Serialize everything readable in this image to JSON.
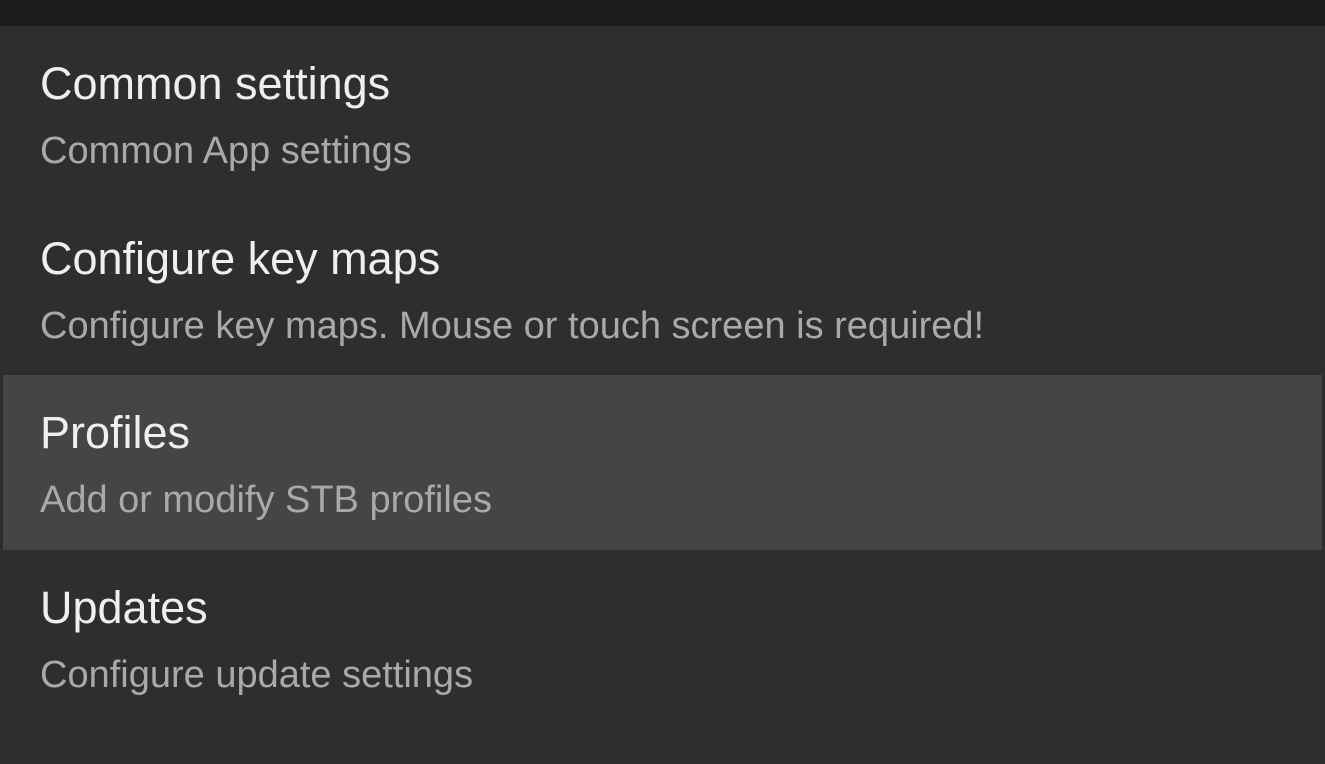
{
  "settings": {
    "items": [
      {
        "title": "Common settings",
        "summary": "Common App settings",
        "selected": false
      },
      {
        "title": "Configure key maps",
        "summary": "Configure key maps. Mouse or touch screen is required!",
        "selected": false
      },
      {
        "title": "Profiles",
        "summary": "Add or modify STB profiles",
        "selected": true
      },
      {
        "title": "Updates",
        "summary": "Configure update settings",
        "selected": false
      }
    ]
  },
  "colors": {
    "background": "#2e2e30",
    "top_bar": "#1c1c1e",
    "selected_item": "#454547",
    "title_text": "#efefef",
    "summary_text": "#a9a9ab"
  }
}
